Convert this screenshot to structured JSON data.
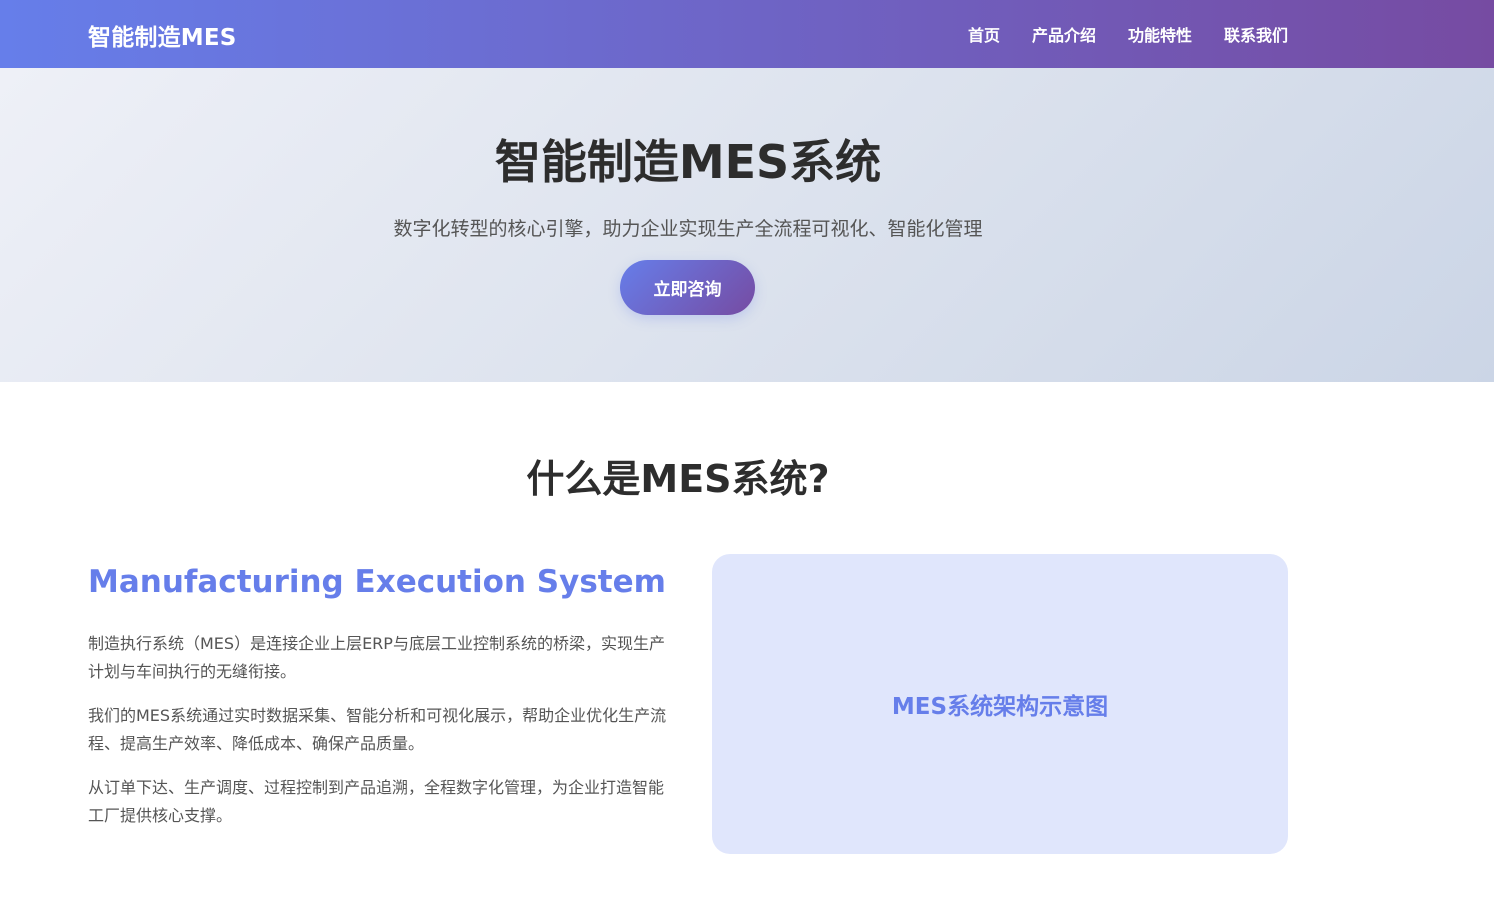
{
  "header": {
    "brand": "智能制造MES",
    "nav": [
      "首页",
      "产品介绍",
      "功能特性",
      "联系我们"
    ]
  },
  "hero": {
    "title": "智能制造MES系统",
    "subtitle": "数字化转型的核心引擎，助力企业实现生产全流程可视化、智能化管理",
    "cta_label": "立即咨询"
  },
  "about": {
    "section_title": "什么是MES系统?",
    "heading": "Manufacturing Execution System",
    "paragraphs": [
      "制造执行系统（MES）是连接企业上层ERP与底层工业控制系统的桥梁，实现生产计划与车间执行的无缝衔接。",
      "我们的MES系统通过实时数据采集、智能分析和可视化展示，帮助企业优化生产流程、提高生产效率、降低成本、确保产品质量。",
      "从订单下达、生产调度、过程控制到产品追溯，全程数字化管理，为企业打造智能工厂提供核心支撑。"
    ],
    "diagram_label": "MES系统架构示意图"
  },
  "colors": {
    "accent": "#667eea",
    "accent_dark": "#764ba2",
    "diagram_bg": "#e0e6fc"
  }
}
